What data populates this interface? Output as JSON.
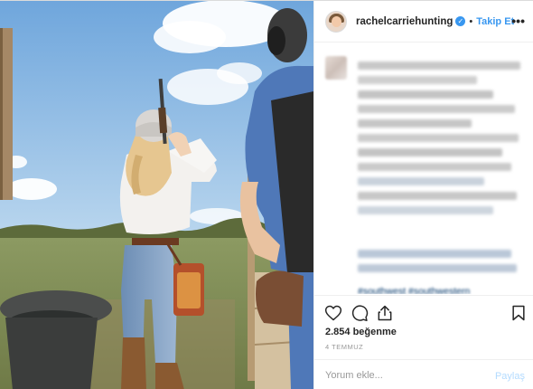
{
  "post": {
    "username": "rachelcarriehunting",
    "verified_icon": "verified-badge-icon",
    "separator": "•",
    "follow_label": "Takip Et",
    "more_label": "•••"
  },
  "actions": {
    "like_icon": "heart-icon",
    "comment_icon": "comment-icon",
    "share_icon": "share-icon",
    "save_icon": "bookmark-icon"
  },
  "likes_text": "2.854 beğenme",
  "date_text": "4 TEMMUZ",
  "comment": {
    "placeholder": "Yorum ekle...",
    "post_label": "Paylaş"
  },
  "caption": {
    "hashtags_visible": "#southwest #southwestern"
  },
  "colors": {
    "accent": "#3897f0",
    "post_disabled": "#b3dbff",
    "text": "#262626",
    "muted": "#999999"
  }
}
